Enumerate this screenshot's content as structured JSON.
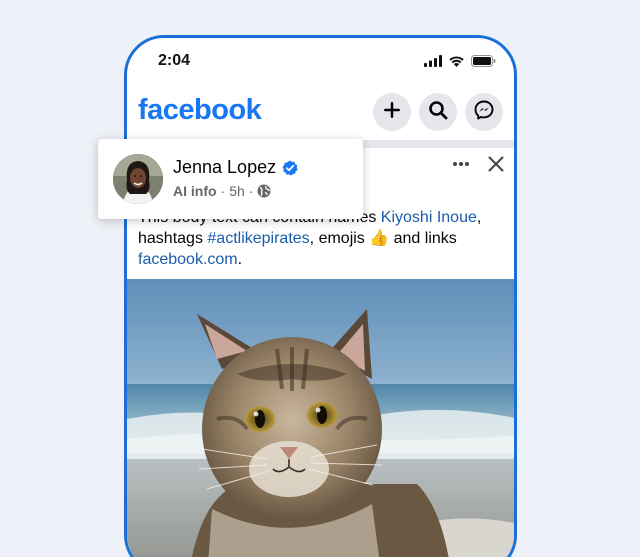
{
  "status_bar": {
    "time": "2:04",
    "icons": [
      "signal-icon",
      "wifi-icon",
      "battery-icon"
    ]
  },
  "header": {
    "logo": "facebook",
    "buttons": [
      "plus-icon",
      "search-icon",
      "messenger-icon"
    ]
  },
  "post": {
    "author": {
      "name": "Jenna Lopez",
      "verified_icon": "verified-badge-icon",
      "meta_label": "AI info",
      "separator": "·",
      "time": "5h",
      "audience_icon": "globe-icon"
    },
    "text": {
      "part1": "This body text can contain names ",
      "mention": "Kiyoshi Inoue",
      "part2": ", hashtags ",
      "hashtag": "#actlikepirates",
      "part3": ", emojis ",
      "emoji": "👍",
      "part4": " and links ",
      "link": "facebook.com",
      "part5": "."
    },
    "image_subject": "cat-photo"
  },
  "colors": {
    "brand": "#1877f2",
    "link": "#1b5cab",
    "phone_border": "#1a6fd8",
    "background": "#eef1f7"
  }
}
